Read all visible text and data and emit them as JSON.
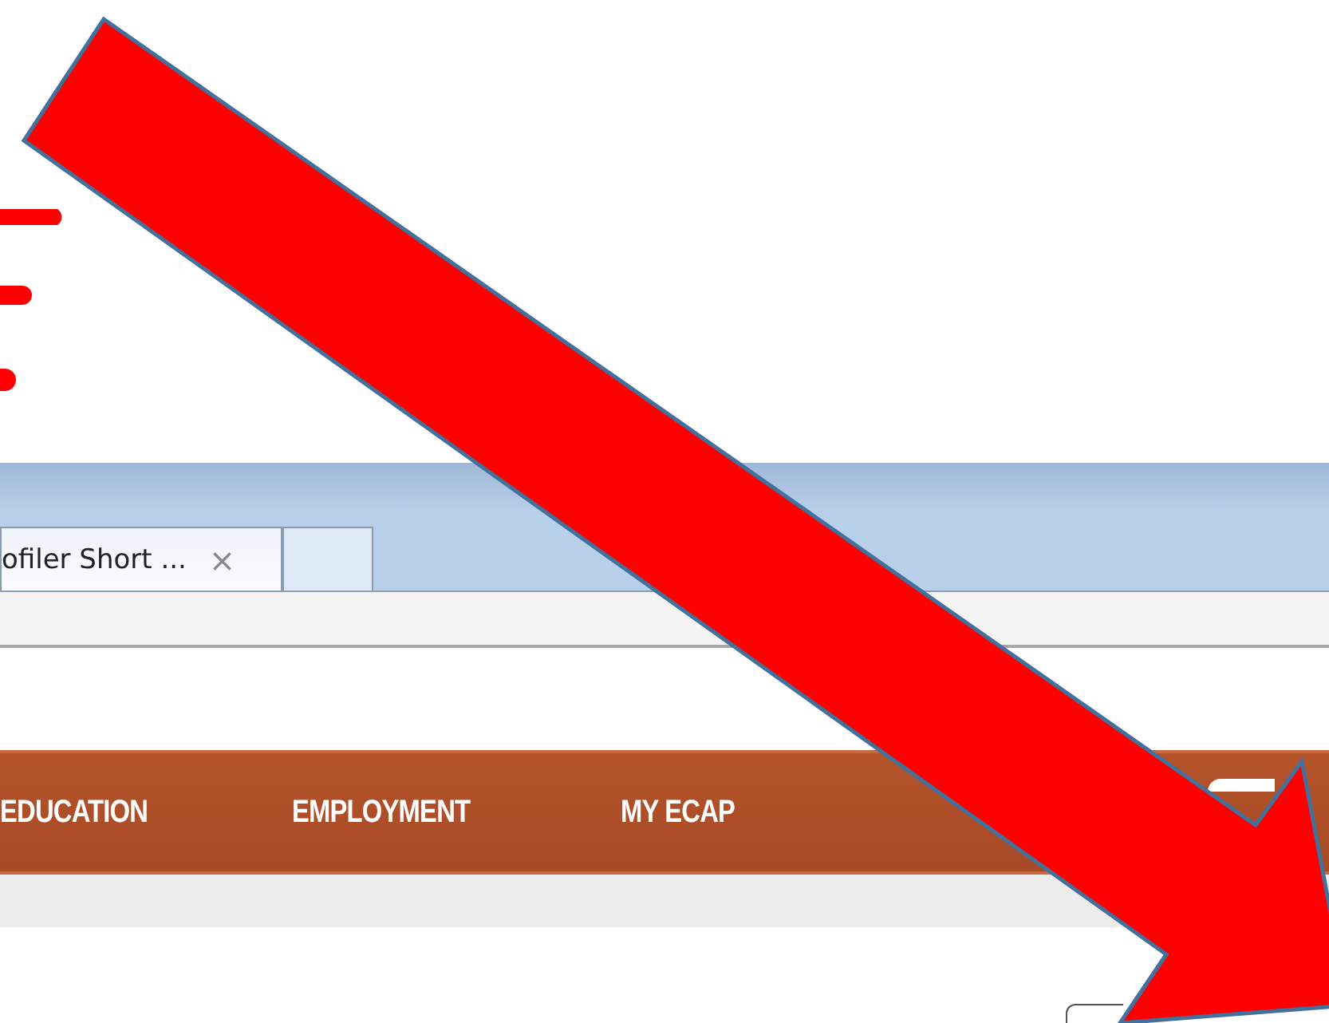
{
  "tabs": [
    {
      "label": "ofiler Short ...",
      "close": "×",
      "selected": true
    },
    {
      "selected": false
    }
  ],
  "nav_items": [
    {
      "label": "EDUCATION"
    },
    {
      "label": "EMPLOYMENT"
    },
    {
      "label": "MY ECAP"
    }
  ]
}
